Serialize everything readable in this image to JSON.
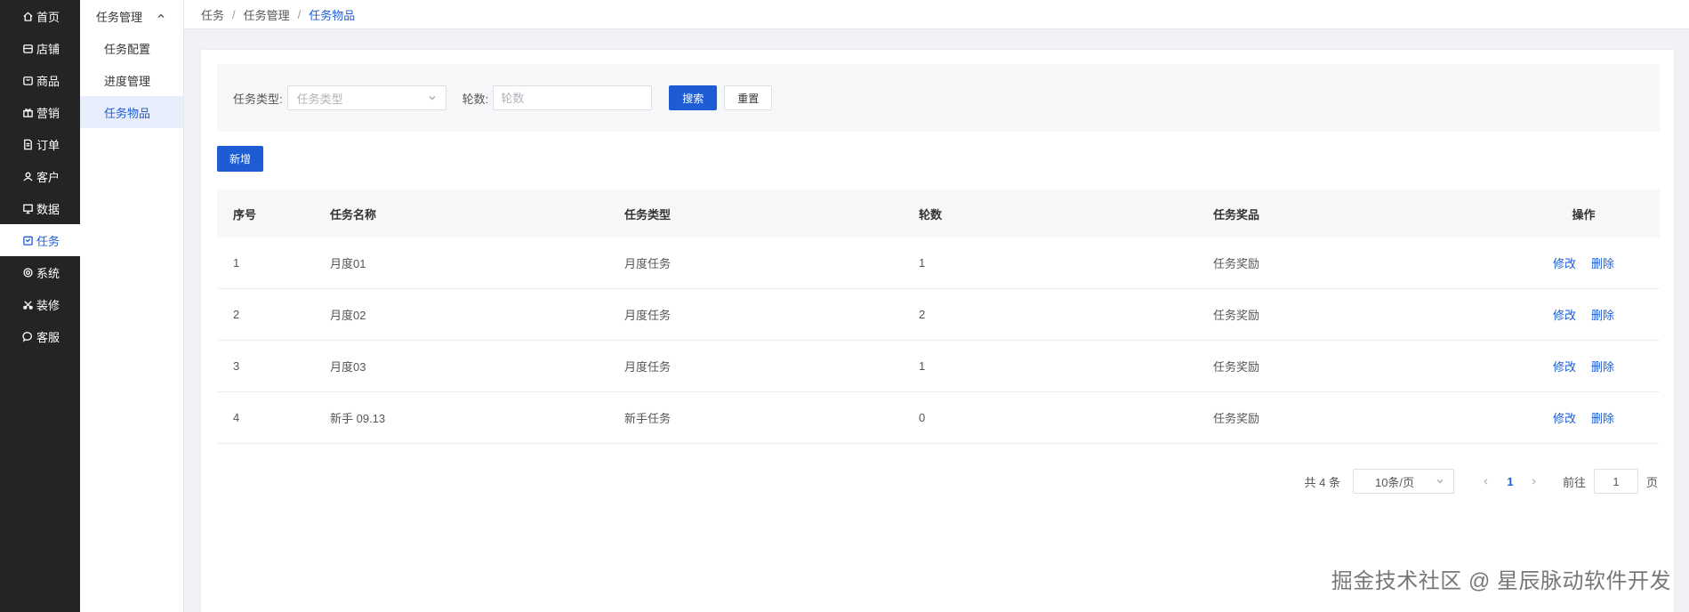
{
  "nav": {
    "items": [
      {
        "label": "首页",
        "icon": "home-icon"
      },
      {
        "label": "店铺",
        "icon": "store-icon"
      },
      {
        "label": "商品",
        "icon": "bag-icon"
      },
      {
        "label": "营销",
        "icon": "gift-icon"
      },
      {
        "label": "订单",
        "icon": "document-icon"
      },
      {
        "label": "客户",
        "icon": "users-icon"
      },
      {
        "label": "数据",
        "icon": "chart-icon"
      },
      {
        "label": "任务",
        "icon": "task-icon"
      },
      {
        "label": "系统",
        "icon": "gear-icon"
      },
      {
        "label": "装修",
        "icon": "brush-icon"
      },
      {
        "label": "客服",
        "icon": "chat-icon"
      }
    ],
    "active_index": 7
  },
  "submenu": {
    "title": "任务管理",
    "items": [
      "任务配置",
      "进度管理",
      "任务物品"
    ],
    "active_index": 2
  },
  "breadcrumb": {
    "items": [
      "任务",
      "任务管理",
      "任务物品"
    ]
  },
  "filter": {
    "type_label": "任务类型:",
    "type_placeholder": "任务类型",
    "round_label": "轮数:",
    "round_placeholder": "轮数",
    "search_label": "搜索",
    "reset_label": "重置"
  },
  "add_label": "新增",
  "table": {
    "headers": [
      "序号",
      "任务名称",
      "任务类型",
      "轮数",
      "任务奖品",
      "操作"
    ],
    "rows": [
      {
        "index": "1",
        "name": "月度01",
        "type": "月度任务",
        "rounds": "1",
        "prize": "任务奖励",
        "edit": "修改",
        "delete": "删除"
      },
      {
        "index": "2",
        "name": "月度02",
        "type": "月度任务",
        "rounds": "2",
        "prize": "任务奖励",
        "edit": "修改",
        "delete": "删除"
      },
      {
        "index": "3",
        "name": "月度03",
        "type": "月度任务",
        "rounds": "1",
        "prize": "任务奖励",
        "edit": "修改",
        "delete": "删除"
      },
      {
        "index": "4",
        "name": "新手 09.13",
        "type": "新手任务",
        "rounds": "0",
        "prize": "任务奖励",
        "edit": "修改",
        "delete": "删除"
      }
    ]
  },
  "pagination": {
    "total_text": "共 4 条",
    "page_size": "10条/页",
    "current_page": "1",
    "goto_label": "前往",
    "goto_value": "1",
    "page_suffix": "页"
  },
  "watermark": "掘金技术社区 @ 星辰脉动软件开发",
  "colors": {
    "accent": "#1e5cd6",
    "nav_bg": "#242424"
  }
}
